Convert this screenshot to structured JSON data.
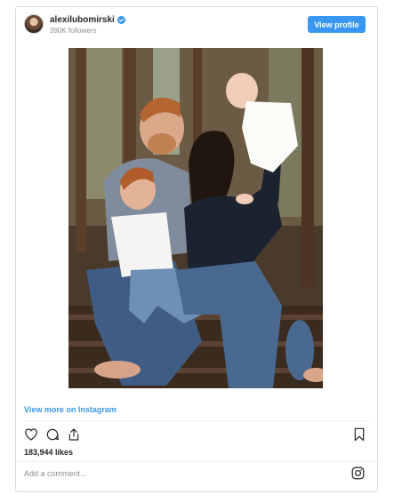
{
  "header": {
    "username": "alexilubomirski",
    "followers": "390K followers",
    "view_profile_label": "View profile"
  },
  "post": {
    "view_more_label": "View more on Instagram",
    "likes": "183,944 likes",
    "comment_placeholder": "Add a comment..."
  },
  "icons": {
    "heart": "heart-icon",
    "comment": "comment-icon",
    "share": "share-icon",
    "bookmark": "bookmark-icon",
    "instagram": "instagram-logo-icon",
    "verified": "verified-badge-icon"
  },
  "colors": {
    "accent": "#3897f0",
    "border": "#dbdbdb",
    "muted": "#8e8e8e",
    "text": "#262626"
  }
}
